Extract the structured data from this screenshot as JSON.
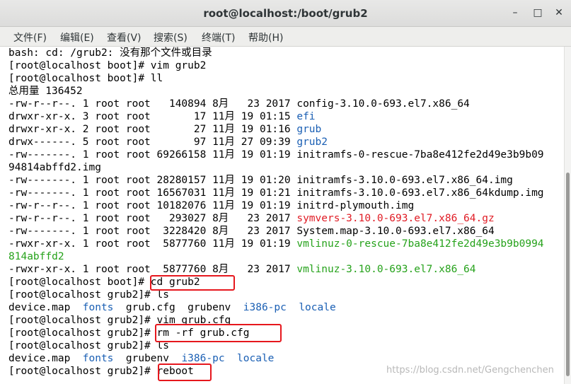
{
  "window": {
    "title": "root@localhost:/boot/grub2",
    "minimize_glyph": "–",
    "maximize_glyph": "□",
    "close_glyph": "✕"
  },
  "menu": [
    "文件(F)",
    "编辑(E)",
    "查看(V)",
    "搜索(S)",
    "终端(T)",
    "帮助(H)"
  ],
  "terminal": {
    "lines": {
      "l0": "bash: cd: /grub2: 没有那个文件或目录",
      "l1": "[root@localhost boot]# vim grub2",
      "l2": "[root@localhost boot]# ll",
      "l3": "总用量 136452",
      "l4a": "-rw-r--r--. 1 root root   140894 8月   23 2017 ",
      "l4b": "config-3.10.0-693.el7.x86_64",
      "l5a": "drwxr-xr-x. 3 root root       17 11月 19 01:15 ",
      "l5b": "efi",
      "l6a": "drwxr-xr-x. 2 root root       27 11月 19 01:16 ",
      "l6b": "grub",
      "l7a": "drwx------. 5 root root       97 11月 27 09:39 ",
      "l7b": "grub2",
      "l8": "-rw-------. 1 root root 69266158 11月 19 01:19 initramfs-0-rescue-7ba8e412fe2d49e3b9b09",
      "l9": "94814abffd2.img",
      "l10": "-rw-------. 1 root root 28280157 11月 19 01:20 initramfs-3.10.0-693.el7.x86_64.img",
      "l11": "-rw-------. 1 root root 16567031 11月 19 01:21 initramfs-3.10.0-693.el7.x86_64kdump.img",
      "l12": "-rw-r--r--. 1 root root 10182076 11月 19 01:19 initrd-plymouth.img",
      "l13a": "-rw-r--r--. 1 root root   293027 8月   23 2017 ",
      "l13b": "symvers-3.10.0-693.el7.x86_64.gz",
      "l14": "-rw-------. 1 root root  3228420 8月   23 2017 System.map-3.10.0-693.el7.x86_64",
      "l15a": "-rwxr-xr-x. 1 root root  5877760 11月 19 01:19 ",
      "l15b": "vmlinuz-0-rescue-7ba8e412fe2d49e3b9b0994",
      "l16": "814abffd2",
      "l17a": "-rwxr-xr-x. 1 root root  5877760 8月   23 2017 ",
      "l17b": "vmlinuz-3.10.0-693.el7.x86_64",
      "l18": "[root@localhost boot]# cd grub2",
      "l19": "[root@localhost grub2]# ls",
      "l20a": "device.map  ",
      "l20b": "fonts",
      "l20c": "  grub.cfg  grubenv  ",
      "l20d": "i386-pc",
      "l20e": "  ",
      "l20f": "locale",
      "l21": "[root@localhost grub2]# vim grub.cfg",
      "l22": "[root@localhost grub2]# rm -rf grub.cfg",
      "l23": "[root@localhost grub2]# ls",
      "l24a": "device.map  ",
      "l24b": "fonts",
      "l24c": "  grubenv  ",
      "l24d": "i386-pc",
      "l24e": "  ",
      "l24f": "locale",
      "l25": "[root@localhost grub2]# reboot"
    }
  },
  "watermark": "https://blog.csdn.net/Gengchenchen",
  "colors": {
    "directory": "#1a5fb4",
    "archive": "#e01b24",
    "executable": "#26a21b",
    "highlight_box": "#e6171d"
  }
}
